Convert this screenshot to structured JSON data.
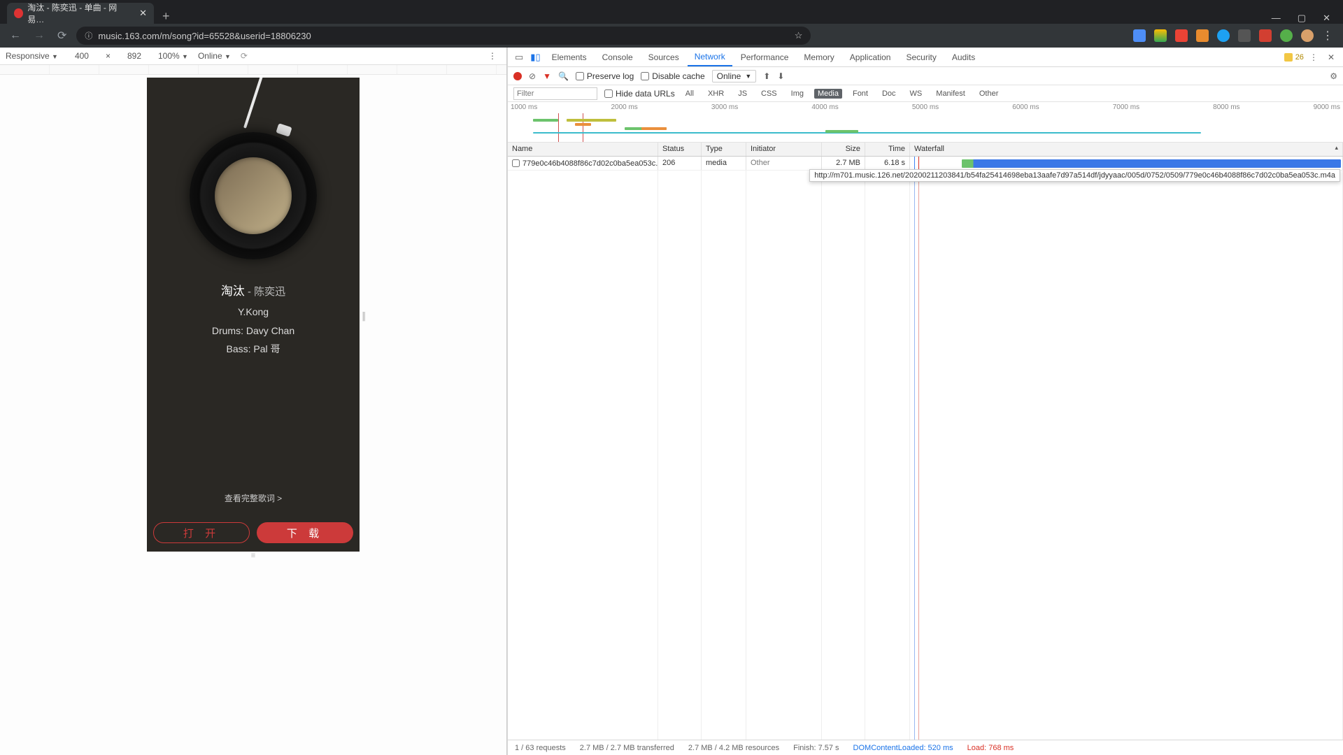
{
  "browser": {
    "tab_title": "淘汰 - 陈奕迅 - 单曲 - 网易…",
    "url": "music.163.com/m/song?id=65528&userid=18806230",
    "win": {
      "min": "—",
      "max": "▢",
      "close": "✕"
    },
    "nav": {
      "back": "←",
      "fwd": "→",
      "reload": "⟳"
    }
  },
  "device_toolbar": {
    "mode": "Responsive",
    "w": "400",
    "sep": "×",
    "h": "892",
    "zoom": "100%",
    "throttle": "Online"
  },
  "music": {
    "title": "淘汰",
    "dash": " - ",
    "artist": "陈奕迅",
    "credit1": "Y.Kong",
    "credit2": "Drums: Davy Chan",
    "credit3": "Bass: Pal 哥",
    "view_lyrics": "查看完整歌词 >",
    "open": "打 开",
    "download": "下 载"
  },
  "devtools": {
    "tabs": [
      "Elements",
      "Console",
      "Sources",
      "Network",
      "Performance",
      "Memory",
      "Application",
      "Security",
      "Audits"
    ],
    "active_tab": 3,
    "warnings": "26",
    "toolbar": {
      "preserve": "Preserve log",
      "disable": "Disable cache",
      "throttle": "Online"
    },
    "filter": {
      "placeholder": "Filter",
      "hide": "Hide data URLs",
      "types": [
        "All",
        "XHR",
        "JS",
        "CSS",
        "Img",
        "Media",
        "Font",
        "Doc",
        "WS",
        "Manifest",
        "Other"
      ],
      "active_type": 5
    },
    "timeline_ticks": [
      "1000 ms",
      "2000 ms",
      "3000 ms",
      "4000 ms",
      "5000 ms",
      "6000 ms",
      "7000 ms",
      "8000 ms",
      "9000 ms"
    ],
    "table": {
      "headers": [
        "Name",
        "Status",
        "Type",
        "Initiator",
        "Size",
        "Time",
        "Waterfall"
      ],
      "row": {
        "name": "779e0c46b4088f86c7d02c0ba5ea053c.m4a",
        "status": "206",
        "type": "media",
        "initiator": "Other",
        "size": "2.7 MB",
        "time": "6.18 s"
      },
      "tooltip": "http://m701.music.126.net/20200211203841/b54fa25414698eba13aafe7d97a514df/jdyyaac/005d/0752/0509/779e0c46b4088f86c7d02c0ba5ea053c.m4a"
    },
    "status": {
      "req": "1 / 63 requests",
      "trans": "2.7 MB / 2.7 MB transferred",
      "res": "2.7 MB / 4.2 MB resources",
      "finish": "Finish: 7.57 s",
      "dcl": "DOMContentLoaded: 520 ms",
      "load": "Load: 768 ms"
    }
  }
}
